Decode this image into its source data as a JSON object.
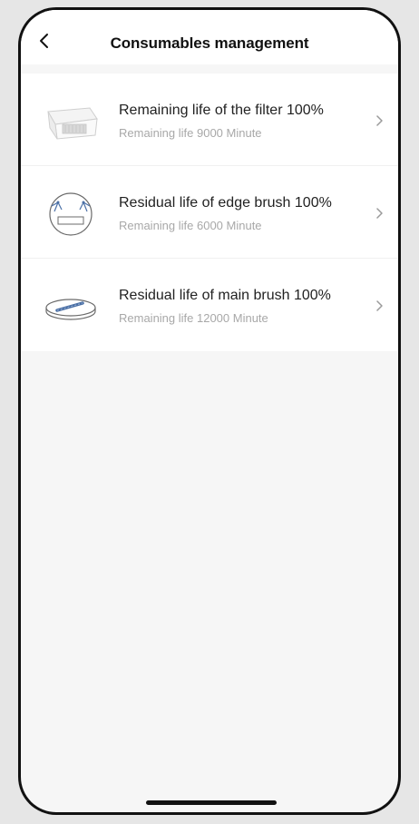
{
  "header": {
    "title": "Consumables management",
    "back_icon": "chevron-left-icon"
  },
  "consumables": [
    {
      "label": "Remaining life of the filter 100%",
      "detail": "Remaining life 9000 Minute",
      "icon": "filter-icon",
      "percent": 100
    },
    {
      "label": "Residual life of edge brush 100%",
      "detail": "Remaining life 6000 Minute",
      "icon": "edge-brush-icon",
      "percent": 100
    },
    {
      "label": "Residual life of main brush 100%",
      "detail": "Remaining life 12000 Minute",
      "icon": "main-brush-icon",
      "percent": 100
    }
  ],
  "colors": {
    "background": "#f6f6f6",
    "card": "#ffffff",
    "primary_text": "#222222",
    "secondary_text": "#a8a8a8",
    "brush_accent": "#4a6fa5"
  }
}
